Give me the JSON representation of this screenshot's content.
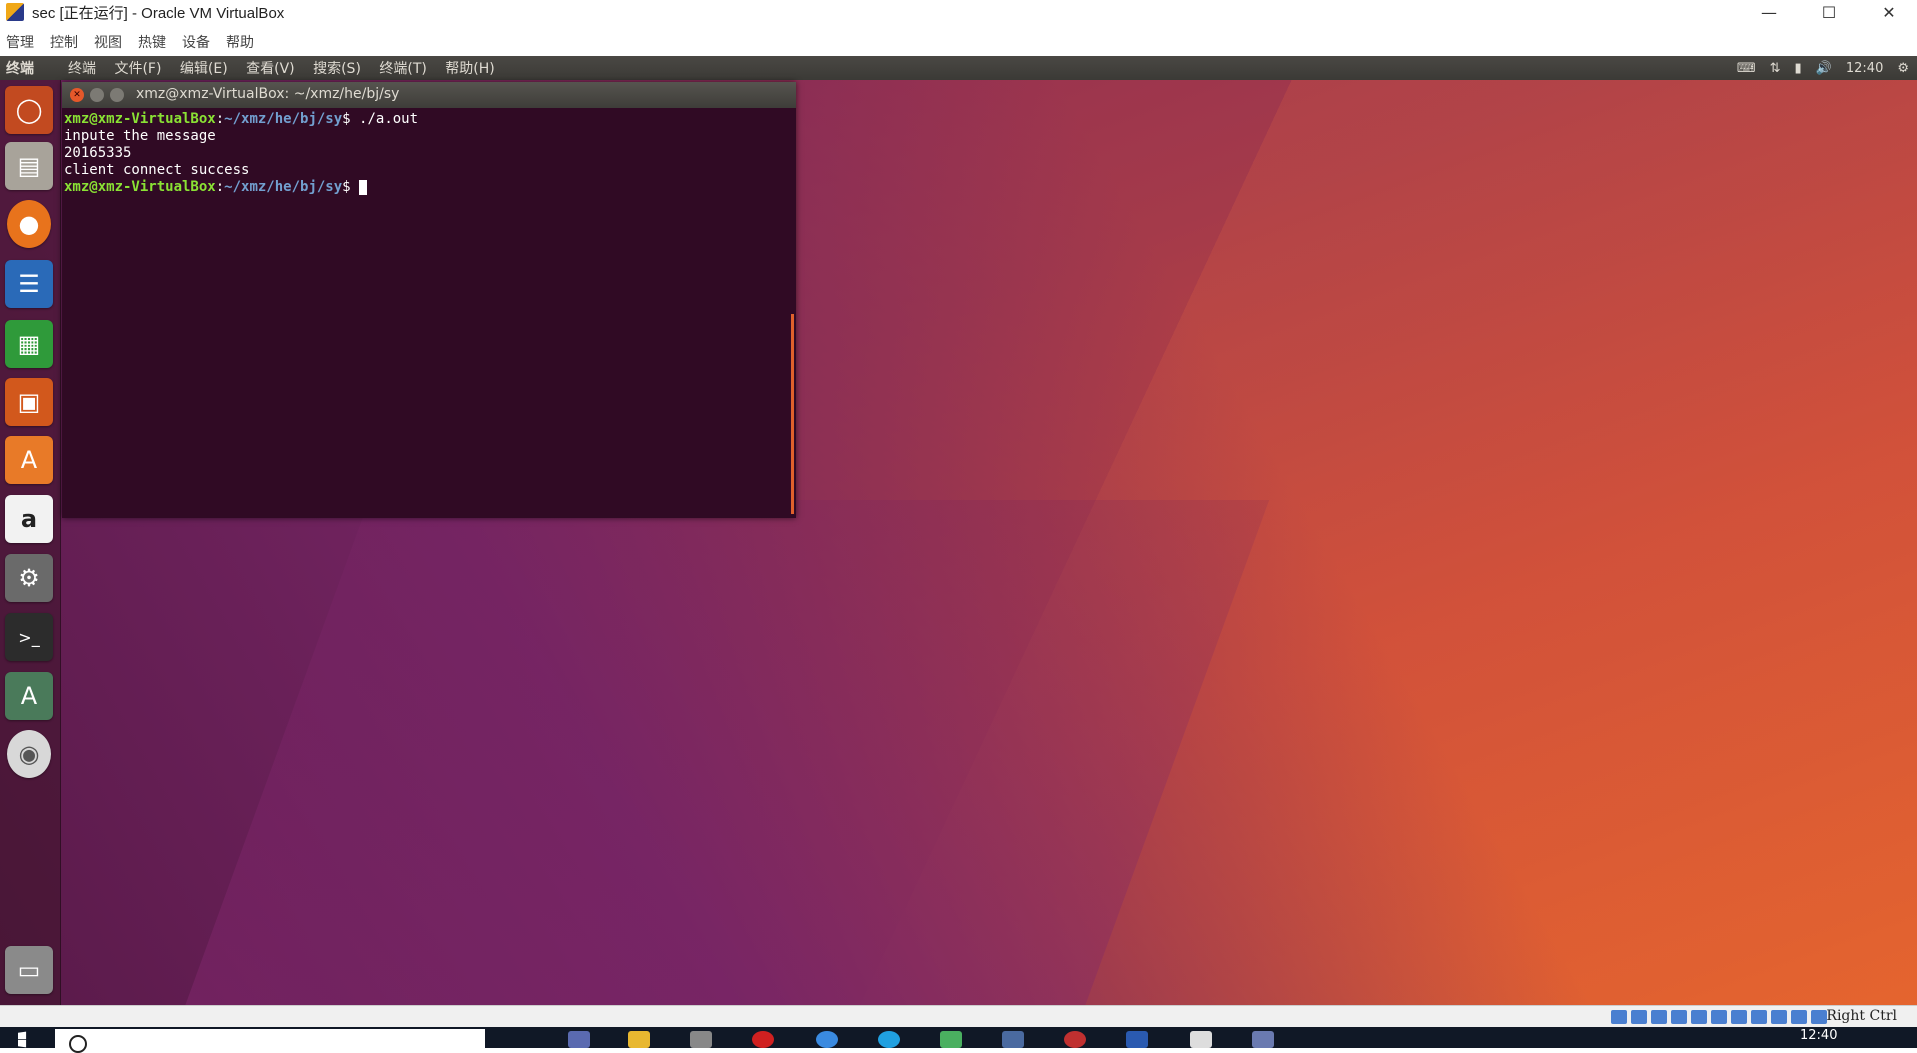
{
  "host_window": {
    "title": "sec [正在运行] - Oracle VM VirtualBox",
    "menu": [
      "管理",
      "控制",
      "视图",
      "热键",
      "设备",
      "帮助"
    ]
  },
  "ubuntu_panel": {
    "app_name": "终端",
    "menus": [
      "终端",
      "文件(F)",
      "编辑(E)",
      "查看(V)",
      "搜索(S)",
      "终端(T)",
      "帮助(H)"
    ],
    "clock": "12:40"
  },
  "launcher": {
    "items": [
      "ubuntu-dash-icon",
      "files-icon",
      "firefox-icon",
      "writer-icon",
      "calc-icon",
      "impress-icon",
      "software-center-icon",
      "amazon-icon",
      "system-settings-icon",
      "terminal-icon",
      "software-updater-icon",
      "dvd-icon"
    ],
    "trash": "trash-icon"
  },
  "terminal": {
    "title": "xmz@xmz-VirtualBox: ~/xmz/he/bj/sy",
    "prompt_user": "xmz@xmz-VirtualBox",
    "prompt_sep": ":",
    "prompt_path": "~/xmz/he/bj/sy",
    "prompt_end": "$",
    "command": " ./a.out",
    "output": [
      "inpute the message",
      "20165335",
      "client connect success"
    ]
  },
  "vbox_status": {
    "host_key": "Right Ctrl"
  },
  "taskbar": {
    "clock": "12:40"
  },
  "colors": {
    "terminal_bg": "#300a24",
    "prompt_user": "#8ae234",
    "prompt_path": "#729fcf",
    "accent": "#e0612c"
  }
}
